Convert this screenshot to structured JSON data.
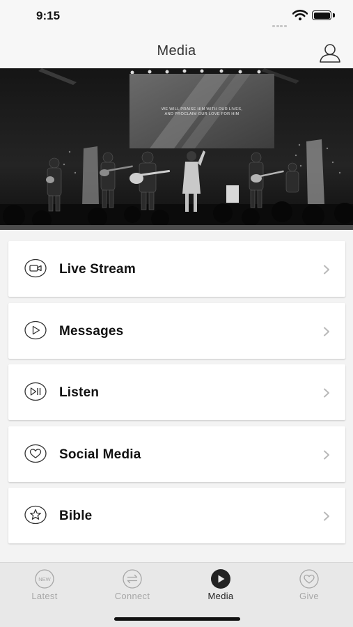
{
  "status_bar": {
    "time": "9:15",
    "icons": [
      "cellular-signal-icon",
      "wifi-icon",
      "battery-icon"
    ]
  },
  "nav": {
    "title": "Media",
    "profile_icon": "user-icon"
  },
  "hero": {
    "image_semantic": "worship-band-on-stage-photo",
    "caption_line1": "WE WILL PRAISE HIM WITH OUR LIVES,",
    "caption_line2": "AND PROCLAIM OUR LOVE FOR HIM"
  },
  "menu": {
    "items": [
      {
        "label": "Live Stream",
        "icon": "video-camera-icon"
      },
      {
        "label": "Messages",
        "icon": "play-icon"
      },
      {
        "label": "Listen",
        "icon": "play-pause-icon"
      },
      {
        "label": "Social Media",
        "icon": "heart-icon"
      },
      {
        "label": "Bible",
        "icon": "star-icon"
      }
    ],
    "chevron_icon": "chevron-right-icon"
  },
  "tabs": [
    {
      "label": "Latest",
      "icon": "new-badge-icon",
      "icon_text": "NEW",
      "active": false
    },
    {
      "label": "Connect",
      "icon": "exchange-arrows-icon",
      "active": false
    },
    {
      "label": "Media",
      "icon": "play-circle-icon",
      "active": true
    },
    {
      "label": "Give",
      "icon": "heart-circle-icon",
      "active": false
    }
  ],
  "colors": {
    "background": "#f3f3f3",
    "card": "#ffffff",
    "tab_bar": "#e8e8e8",
    "active_tab": "#222222",
    "inactive_tab": "#a6a6a6"
  }
}
